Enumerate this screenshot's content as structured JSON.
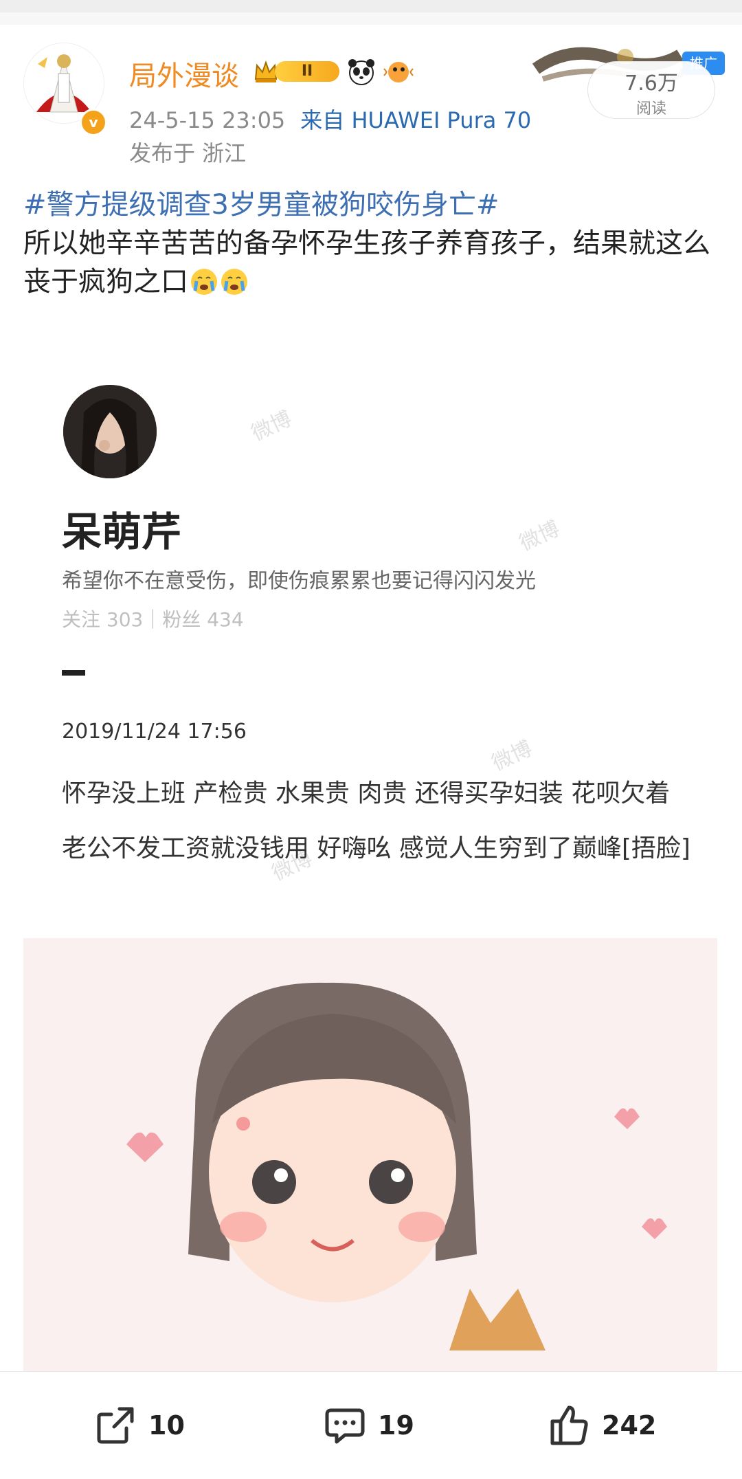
{
  "header": {
    "username": "局外漫谈",
    "level": "II",
    "timestamp": "24-5-15 23:05",
    "source": "来自 HUAWEI Pura 70",
    "location": "发布于 浙江"
  },
  "ad": {
    "tag": "推广",
    "read_count": "7.6万",
    "read_label": "阅读"
  },
  "post": {
    "hashtag": "#警方提级调查3岁男童被狗咬伤身亡#",
    "text": "所以她辛辛苦苦的备孕怀孕生孩子养育孩子，结果就这么丧于疯狗之口"
  },
  "embedded": {
    "name": "呆萌芹",
    "bio": "希望你不在意受伤，即使伤痕累累也要记得闪闪发光",
    "stats": "关注 303｜粉丝 434",
    "date": "2019/11/24 17:56",
    "text": "怀孕没上班  产检贵  水果贵 肉贵  还得买孕妇装 花呗欠着 老公不发工资就没钱用  好嗨吆  感觉人生穷到了巅峰[捂脸]"
  },
  "actions": {
    "repost": "10",
    "comment": "19",
    "like": "242"
  },
  "icons": {
    "repost": "share-icon",
    "comment": "comment-icon",
    "like": "thumbs-up-icon",
    "verified": "verified-icon",
    "crown": "crown-icon"
  },
  "colors": {
    "username": "#f08a23",
    "hashtag": "#3d6fb2",
    "ad_tag": "#2d8cf0"
  }
}
